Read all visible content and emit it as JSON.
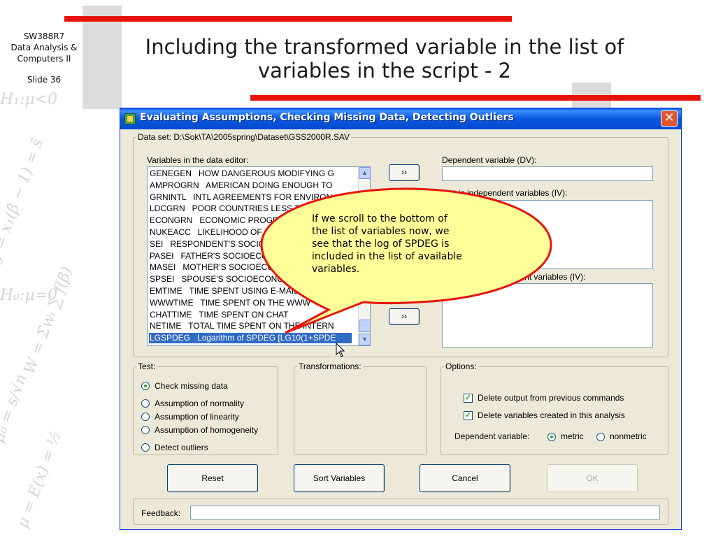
{
  "slide": {
    "course": "SW388R7",
    "course_line2": "Data Analysis &",
    "course_line3": "Computers II",
    "slide_number": "Slide 36",
    "title_line1": "Including the transformed variable in the list of",
    "title_line2": "variables in the script - 2",
    "accent_color": "#e8140c"
  },
  "dialog": {
    "title": "Evaluating Assumptions, Checking Missing Data, Detecting Outliers",
    "close_icon": "close-icon",
    "dataset_label": "Data set: D:\\Sok\\TA\\2005spring\\Dataset\\GSS2000R.SAV",
    "variables": {
      "label": "Variables in the data editor:",
      "items": [
        "GENEGEN   HOW DANGEROUS MODIFYING G",
        "AMPROGRN   AMERICAN DOING ENOUGH TO",
        "GRNINTL   INTL AGREEMENTS FOR ENVIRON",
        "LDCGRN   POOR COUNTRIES LESS THAN",
        "ECONGRN   ECONOMIC PROGRESS",
        "NUKEACC   LIKELIHOOD OF",
        "SEI   RESPONDENT'S SOCIO",
        "PASEI   FATHER'S SOCIOECONOMIC",
        "MASEI   MOTHER'S SOCIOECONOMIC",
        "SPSEI   SPOUSE'S SOCIOECONOMIC",
        "EMTIME   TIME SPENT USING E-MAIL",
        "WWWTIME   TIME SPENT ON THE WWW",
        "CHATTIME   TIME SPENT ON CHAT",
        "NETIME   TOTAL TIME SPENT ON THE INTERN",
        "LGSPDEG   Logarithm of SPDEG [LG10(1+SPDE"
      ],
      "selected_index": 14
    },
    "move_button_label": "››",
    "dv": {
      "label": "Dependent variable (DV):",
      "value": ""
    },
    "metric_iv": {
      "label": "Metric independent variables (IV):"
    },
    "nonmetric_iv": {
      "label": "Non-metric independent variables (IV):"
    },
    "test": {
      "legend": "Test:",
      "options": [
        "Check missing data",
        "Assumption of normality",
        "Assumption of linearity",
        "Assumption of homogeneity",
        "Detect outliers"
      ],
      "selected": "Check missing data"
    },
    "transformations": {
      "legend": "Transformations:"
    },
    "options": {
      "legend": "Options:",
      "delete_output": "Delete output from previous commands",
      "delete_output_checked": true,
      "delete_vars": "Delete variables created in this analysis",
      "delete_vars_checked": true,
      "dep_var_label": "Dependent variable:",
      "metric": "metric",
      "nonmetric": "nonmetric",
      "dep_var_selected": "metric"
    },
    "buttons": {
      "reset": "Reset",
      "sort": "Sort Variables",
      "cancel": "Cancel",
      "ok": "OK"
    },
    "feedback": {
      "label": "Feedback:",
      "value": ""
    }
  },
  "callout": {
    "line1": "If we scroll to the bottom of",
    "line2": "the list of variables now, we",
    "line3": "see that the log of SPDEG is",
    "line4": "included in the list of available",
    "line5": "variables.",
    "fill_color": "#ffff99",
    "border_color": "#e8140c"
  }
}
